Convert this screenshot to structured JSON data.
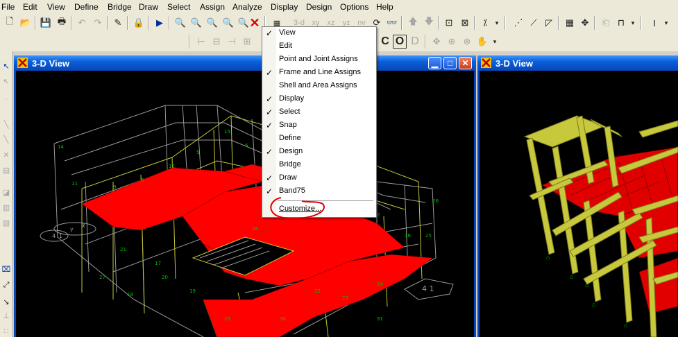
{
  "menubar": {
    "items": [
      "File",
      "Edit",
      "View",
      "Define",
      "Bridge",
      "Draw",
      "Select",
      "Assign",
      "Analyze",
      "Display",
      "Design",
      "Options",
      "Help"
    ]
  },
  "toolbar": {
    "view_buttons": [
      "3-d",
      "xy",
      "xz",
      "yz",
      "nv"
    ],
    "show_labels": [
      "C",
      "O",
      "D"
    ]
  },
  "icons": {
    "toolbar1": [
      "new-file-icon",
      "open-folder-icon",
      "save-icon",
      "print-icon",
      "undo-icon",
      "redo-icon",
      "pencil-icon",
      "lock-icon",
      "run-icon",
      "zoom-window-icon",
      "zoom-in-icon",
      "zoom-out-icon",
      "zoom-restore-icon",
      "zoom-previous-icon",
      "delete-x-icon",
      "set-display-icon"
    ],
    "left_toolbar": [
      "pointer-icon",
      "reshape-icon",
      "draw-point-icon",
      "draw-line-icon",
      "draw-brace-icon",
      "draw-area-icon",
      "snap-icon"
    ]
  },
  "windows": [
    {
      "title": "3-D View",
      "active": false
    },
    {
      "title": "3-D View",
      "active": true
    }
  ],
  "context_menu": {
    "items": [
      {
        "label": "View",
        "checked": true
      },
      {
        "label": "Edit",
        "checked": false
      },
      {
        "label": "Point and Joint Assigns",
        "checked": false
      },
      {
        "label": "Frame and Line Assigns",
        "checked": true
      },
      {
        "label": "Shell and Area Assigns",
        "checked": false
      },
      {
        "label": "Display",
        "checked": true
      },
      {
        "label": "Select",
        "checked": true
      },
      {
        "label": "Snap",
        "checked": true
      },
      {
        "label": "Define",
        "checked": false
      },
      {
        "label": "Design",
        "checked": true
      },
      {
        "label": "Bridge",
        "checked": false
      },
      {
        "label": "Draw",
        "checked": true
      },
      {
        "label": "Band75",
        "checked": true
      }
    ],
    "customize_label": "Customize...",
    "check_glyph": "✓"
  },
  "model": {
    "left_grid_labels": [
      "y",
      "x",
      "4",
      "1"
    ],
    "annotation_right": "4 1"
  },
  "colors": {
    "titlebar": "#0a5fd8",
    "slab_red": "#ff0000",
    "frame_yellow": "#c8c83c",
    "annotation_red": "#e00000",
    "grid_green": "#00c000"
  }
}
